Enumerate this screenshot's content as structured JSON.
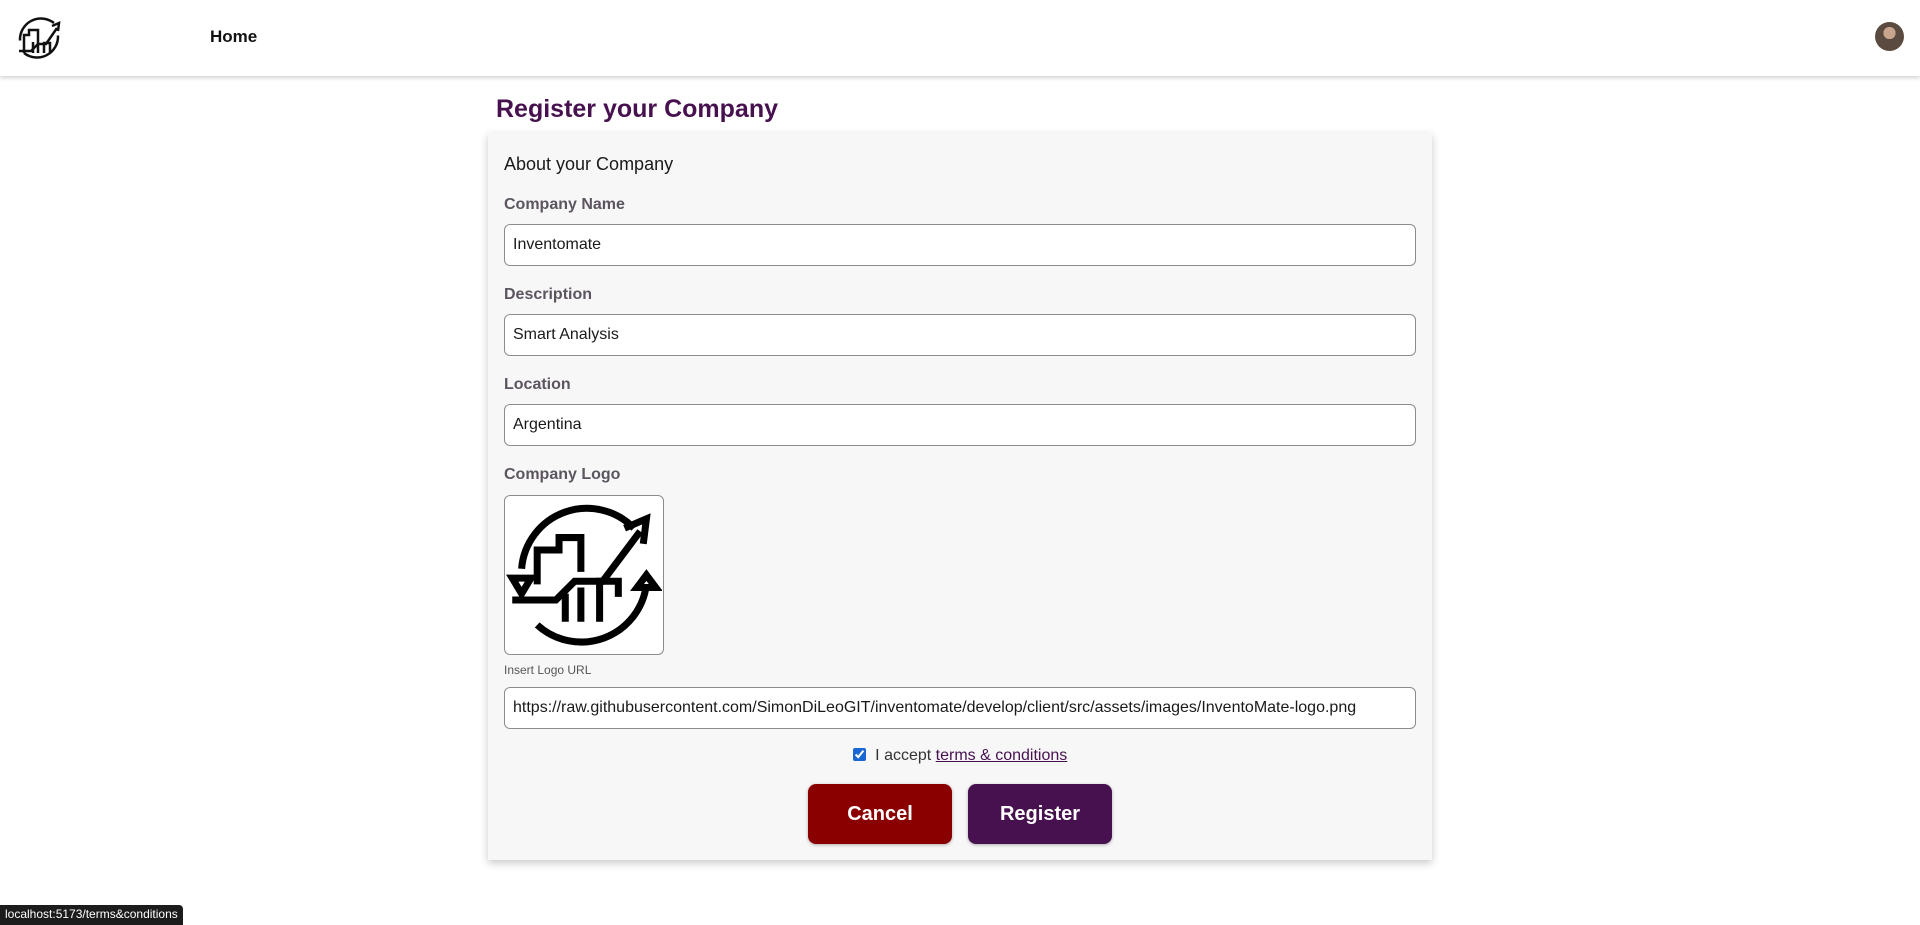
{
  "nav": {
    "home_label": "Home"
  },
  "page": {
    "title": "Register your Company"
  },
  "form": {
    "heading": "About your Company",
    "company_name": {
      "label": "Company Name",
      "value": "Inventomate"
    },
    "description": {
      "label": "Description",
      "value": "Smart Analysis"
    },
    "location": {
      "label": "Location",
      "value": "Argentina"
    },
    "company_logo": {
      "label": "Company Logo"
    },
    "logo_url": {
      "label": "Insert Logo URL",
      "value": "https://raw.githubusercontent.com/SimonDiLeoGIT/inventomate/develop/client/src/assets/images/InventoMate-logo.png"
    },
    "terms": {
      "checked": true,
      "prefix": "I accept",
      "link_text": "terms & conditions"
    },
    "cancel_label": "Cancel",
    "register_label": "Register"
  },
  "status_bar": {
    "text": "localhost:5173/terms&conditions"
  },
  "colors": {
    "brand": "#47114f",
    "cancel": "#8a0000"
  }
}
